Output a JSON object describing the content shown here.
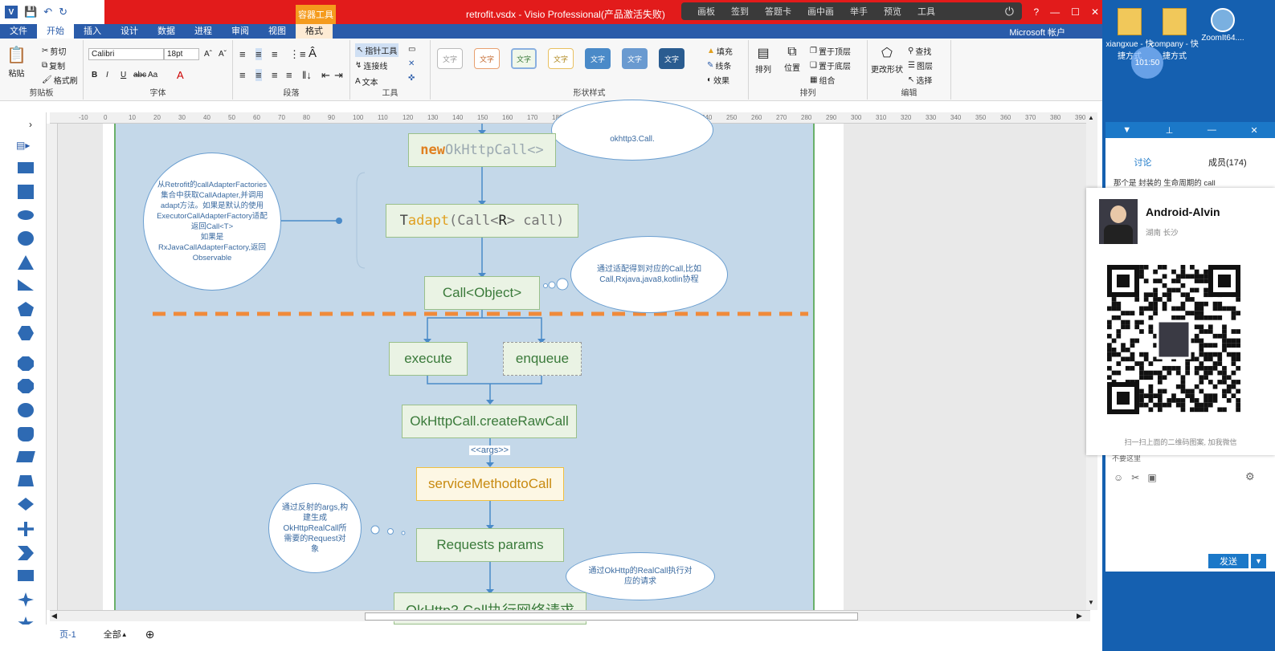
{
  "titlebar": {
    "context_tab": "容器工具",
    "title": "retrofit.vsdx -  Visio Professional(产品激活失败)",
    "annotation_tools": [
      "画板",
      "签到",
      "答题卡",
      "画中画",
      "举手",
      "预览",
      "工具"
    ],
    "controls": [
      "?",
      "—",
      "☐",
      "✕"
    ]
  },
  "tabs": [
    "文件",
    "开始",
    "插入",
    "设计",
    "数据",
    "进程",
    "审阅",
    "视图",
    "格式"
  ],
  "account": "Microsoft 帐户",
  "ribbon": {
    "clipboard": {
      "paste": "粘贴",
      "cut": "剪切",
      "copy": "复制",
      "format_painter": "格式刷",
      "label": "剪贴板"
    },
    "font": {
      "name": "Calibri",
      "size": "18pt",
      "label": "字体"
    },
    "paragraph": {
      "label": "段落"
    },
    "tools": {
      "pointer": "指针工具",
      "connector": "连接线",
      "text": "文本",
      "label": "工具"
    },
    "shape_styles": {
      "swatch_text": "文字",
      "fill": "填充",
      "line": "线条",
      "effect": "效果",
      "label": "形状样式"
    },
    "arrange": {
      "arrange": "排列",
      "position": "位置",
      "bring_front": "置于顶层",
      "send_back": "置于底层",
      "group": "组合",
      "label": "排列"
    },
    "editing": {
      "change_shape": "更改形状",
      "find": "查找",
      "layers": "图层",
      "select": "选择",
      "label": "编辑"
    }
  },
  "ruler_ticks": [
    "-10",
    "0",
    "10",
    "20",
    "30",
    "40",
    "50",
    "60",
    "70",
    "80",
    "90",
    "100",
    "110",
    "120",
    "130",
    "140",
    "150",
    "160",
    "170",
    "180",
    "190",
    "200",
    "210",
    "220",
    "230",
    "240",
    "250",
    "260",
    "270",
    "280",
    "290",
    "300",
    "310",
    "320",
    "330",
    "340",
    "350",
    "360",
    "370",
    "380",
    "390"
  ],
  "diagram": {
    "top_cloud": "okhttp3.Call.",
    "new_call": {
      "kw": "new",
      "rest": " OkHttpCall<>"
    },
    "adapt": {
      "t": "T ",
      "fn": "adapt",
      "rest1": "(Call<",
      "r": "R",
      "rest2": "> call)"
    },
    "left_cloud": "从Retrofit的callAdapterFactories集合中获取CallAdapter,并调用adapt方法。如果是默认的使用ExecutorCallAdapterFactory适配返回Call<T>\n如果是RxJavaCallAdapterFactory,返回Observable",
    "call_object": "Call<Object>",
    "right_cloud": "通过适配得到对应的Call,比如Call,Rxjava,java8,kotlin协程",
    "execute": "execute",
    "enqueue": "enqueue",
    "create_raw": "OkHttpCall.createRawCall",
    "args": "<<args>>",
    "service_method": "serviceMethodtoCall",
    "reflect_cloud": "通过反射的args,构建生成OkHttpRealCall所需要的Request对象",
    "requests": "Requests params",
    "realcall_cloud": "通过OkHttp的RealCall执行对应的请求",
    "bottom": "OkHttp3.Call执行网络请求"
  },
  "status": {
    "page": "页-1",
    "all": "全部",
    "add": "⊕"
  },
  "desktop": {
    "icons": [
      "xiangxue - 快捷方式",
      "company - 快捷方式",
      "ZoomIt64...."
    ],
    "clock": "101:50"
  },
  "chat": {
    "tabs": [
      "讨论",
      "成员(174)"
    ],
    "first_message": "那个是 封装的 生命周期的 call",
    "user_name": "Android-Alvin",
    "user_location": "湖南 长沙",
    "qr_caption": "扫一扫上面的二维码图案, 加我微信",
    "faded_text": "不要这里",
    "send": "发送"
  }
}
